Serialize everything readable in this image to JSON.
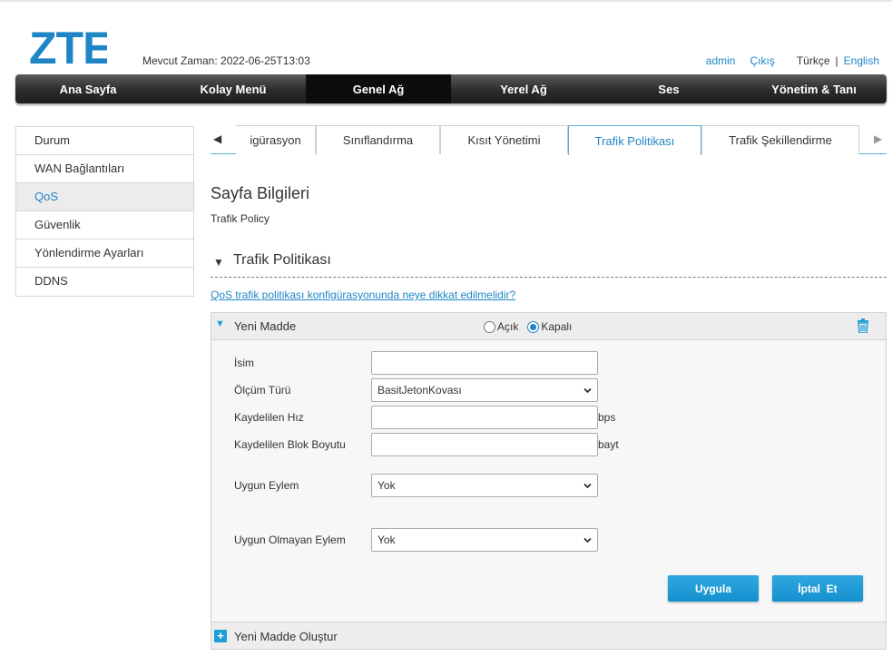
{
  "header": {
    "logo_text": "ZTE",
    "time_label": "Mevcut Zaman: 2022-06-25T13:03",
    "user_link": "admin",
    "logout_link": "Çıkış",
    "lang_current": "Türkçe",
    "lang_sep": "|",
    "lang_other": "English"
  },
  "nav": {
    "items": [
      "Ana Sayfa",
      "Kolay Menü",
      "Genel Ağ",
      "Yerel Ağ",
      "Ses",
      "Yönetim & Tanı"
    ],
    "active_index": 2
  },
  "sidebar": {
    "items": [
      "Durum",
      "WAN Bağlantıları",
      "QoS",
      "Güvenlik",
      "Yönlendirme Ayarları",
      "DDNS"
    ],
    "active_index": 2
  },
  "tabs": {
    "left_arrow": "◀",
    "right_arrow": "▶",
    "items": [
      "igürasyon",
      "Sınıflandırma",
      "Kısıt Yönetimi",
      "Trafik Politikası",
      "Trafik Şekillendirme"
    ],
    "active_index": 3
  },
  "page": {
    "title": "Sayfa Bilgileri",
    "subtitle": "Trafik Policy",
    "section_title": "Trafik Politikası",
    "help_link": "QoS trafik politikası konfigürasyonunda neye dikkat edilmelidir?"
  },
  "panel": {
    "title": "Yeni Madde",
    "radio_on_label": "Açık",
    "radio_off_label": "Kapalı",
    "selected_radio": "Kapalı",
    "fields": {
      "name_label": "İsim",
      "name_value": "",
      "meter_label": "Ölçüm Türü",
      "meter_value": "BasitJetonKovası",
      "rate_label": "Kaydelilen Hız",
      "rate_unit": "bps",
      "block_label": "Kaydelilen Blok Boyutu",
      "block_unit": "bayt",
      "conform_label": "Uygun Eylem",
      "conform_value": "Yok",
      "nonconform_label": "Uygun Olmayan Eylem",
      "nonconform_value": "Yok"
    },
    "apply_button": "Uygula",
    "cancel_button": "İptal  Et",
    "create_new": "Yeni Madde Oluştur"
  },
  "colors": {
    "accent": "#1f86c6",
    "nav_dark": "#2b2b2b",
    "button": "#1f9ed8"
  }
}
